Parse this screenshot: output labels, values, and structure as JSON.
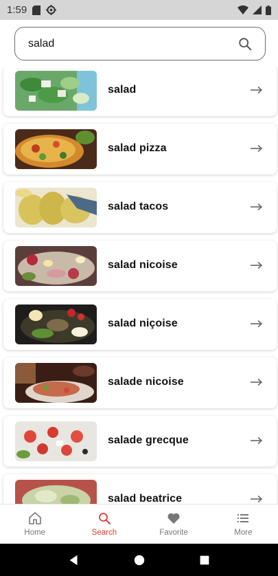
{
  "status_bar": {
    "time": "1:59",
    "left_icons": [
      "sd-card-icon",
      "settings-icon"
    ],
    "right_icons": [
      "wifi-icon",
      "cellular-icon",
      "battery-icon"
    ]
  },
  "search": {
    "value": "salad",
    "placeholder": "",
    "icon": "search-icon"
  },
  "results": [
    {
      "label": "salad"
    },
    {
      "label": "salad pizza"
    },
    {
      "label": "salad tacos"
    },
    {
      "label": "salad nicoise"
    },
    {
      "label": "salad niçoise"
    },
    {
      "label": "salade nicoise"
    },
    {
      "label": "salade grecque"
    },
    {
      "label": "salad beatrice"
    }
  ],
  "bottom_nav": {
    "items": [
      {
        "label": "Home",
        "icon": "home-icon"
      },
      {
        "label": "Search",
        "icon": "search-icon",
        "active": true
      },
      {
        "label": "Favorite",
        "icon": "heart-icon"
      },
      {
        "label": "More",
        "icon": "menu-icon"
      }
    ]
  },
  "colors": {
    "accent": "#e53935",
    "nav_inactive": "#777777",
    "status_bar": "#d6d6d6"
  }
}
